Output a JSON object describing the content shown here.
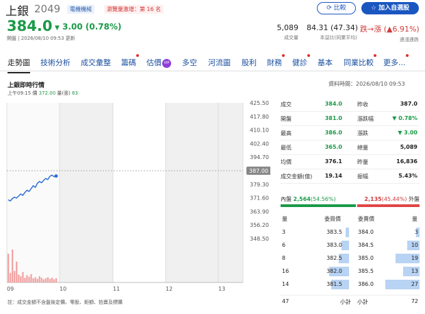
{
  "header": {
    "name": "上銀",
    "code": "2049",
    "tags": [
      "電機機械",
      "瀏覽量激增：第 16 名"
    ],
    "compare_label": "比較",
    "watch_label": "加入自選股",
    "price": "384.0",
    "change": "3.00 (0.78%)",
    "change_arrow": "▼",
    "subline": "開盤 | 2026/08/10 09:53 更新",
    "stats": [
      {
        "value": "5,089",
        "label": "成交量"
      },
      {
        "value": "84.31 (47.34)",
        "label": "本益比(同業平均)"
      },
      {
        "value": "跌→漲 (▲6.91%)",
        "label": "連漲連跌"
      }
    ]
  },
  "nav": {
    "items": [
      "走勢圖",
      "技術分析",
      "成交彙整",
      "籌碼",
      "估價",
      "多空",
      "河流圖",
      "股利",
      "財務",
      "健診",
      "基本",
      "同業比較",
      "更多..."
    ],
    "active": "走勢圖",
    "vip_label": "VIP"
  },
  "intraday": {
    "title": "上銀即時行情",
    "data_time": "資料時間：2026/08/10 09:53",
    "quote_time": "上午09:15",
    "quote_price_label": "價",
    "quote_price": "372.00",
    "quote_vol_label": "量(張)",
    "quote_vol": "63"
  },
  "chart_data": {
    "type": "line",
    "yticks": [
      "425.50",
      "417.80",
      "410.10",
      "402.40",
      "394.70",
      "387.00",
      "379.30",
      "371.60",
      "363.90",
      "356.20",
      "348.50"
    ],
    "ylim": [
      348.5,
      425.5
    ],
    "reference_label": "387.00",
    "reference": 387.0,
    "xticks": [
      "09",
      "10",
      "11",
      "12",
      "13"
    ],
    "price_series": [
      370.5,
      369.8,
      371.2,
      372.0,
      371.5,
      372.6,
      373.8,
      373.0,
      374.6,
      375.9,
      375.2,
      376.8,
      378.5,
      377.6,
      379.8,
      380.9,
      380.2,
      381.5,
      382.6,
      382.0,
      383.8,
      384.5,
      383.6,
      384.0
    ],
    "volume_series": [
      55,
      18,
      63,
      22,
      40,
      15,
      12,
      20,
      9,
      14,
      11,
      16,
      8,
      10,
      7,
      12,
      9,
      6,
      8,
      10,
      7,
      9,
      6,
      8
    ],
    "note": "註：成交金額不含盤後定價、零股、鉅額、拍賣及標購"
  },
  "quote_table": {
    "rows": [
      {
        "l1": "成交",
        "v1": "384.0",
        "c1": "green",
        "l2": "昨收",
        "v2": "387.0",
        "c2": ""
      },
      {
        "l1": "開盤",
        "v1": "381.0",
        "c1": "green",
        "l2": "漲跌幅",
        "v2": "▼ 0.78%",
        "c2": "green"
      },
      {
        "l1": "最高",
        "v1": "386.0",
        "c1": "green",
        "l2": "漲跌",
        "v2": "▼ 3.00",
        "c2": "green"
      },
      {
        "l1": "最低",
        "v1": "365.0",
        "c1": "green",
        "l2": "總量",
        "v2": "5,089",
        "c2": ""
      },
      {
        "l1": "均價",
        "v1": "376.1",
        "c1": "",
        "l2": "昨量",
        "v2": "16,836",
        "c2": ""
      },
      {
        "l1": "成交金額(億)",
        "v1": "19.14",
        "c1": "",
        "l2": "振幅",
        "v2": "5.43%",
        "c2": ""
      }
    ]
  },
  "inout": {
    "in_label": "內盤",
    "in_value": "2,564",
    "in_pct": "(54.56%)",
    "in_ratio": 0.5456,
    "out_value": "2,135",
    "out_pct": "(45.44%)",
    "out_label": "外盤"
  },
  "orderbook": {
    "bid_headers": [
      "量",
      "委買價"
    ],
    "ask_headers": [
      "委賣價",
      "量"
    ],
    "bids": [
      {
        "vol": "3",
        "price": "383.5",
        "level": 0.11
      },
      {
        "vol": "6",
        "price": "383.0",
        "level": 0.22
      },
      {
        "vol": "8",
        "price": "382.5",
        "level": 0.3
      },
      {
        "vol": "16",
        "price": "382.0",
        "level": 0.59
      },
      {
        "vol": "14",
        "price": "381.5",
        "level": 0.52
      }
    ],
    "asks": [
      {
        "price": "384.0",
        "vol": "3",
        "level": 0.11
      },
      {
        "price": "384.5",
        "vol": "10",
        "level": 0.37
      },
      {
        "price": "385.0",
        "vol": "19",
        "level": 0.7
      },
      {
        "price": "385.5",
        "vol": "13",
        "level": 0.48
      },
      {
        "price": "386.0",
        "vol": "27",
        "level": 1.0
      }
    ],
    "bid_total": "47",
    "bid_total_label": "小計",
    "ask_total_label": "小計",
    "ask_total": "72"
  },
  "colors": {
    "up": "#d13a3a",
    "down": "#1b9a48",
    "accent": "#1a56c0"
  }
}
